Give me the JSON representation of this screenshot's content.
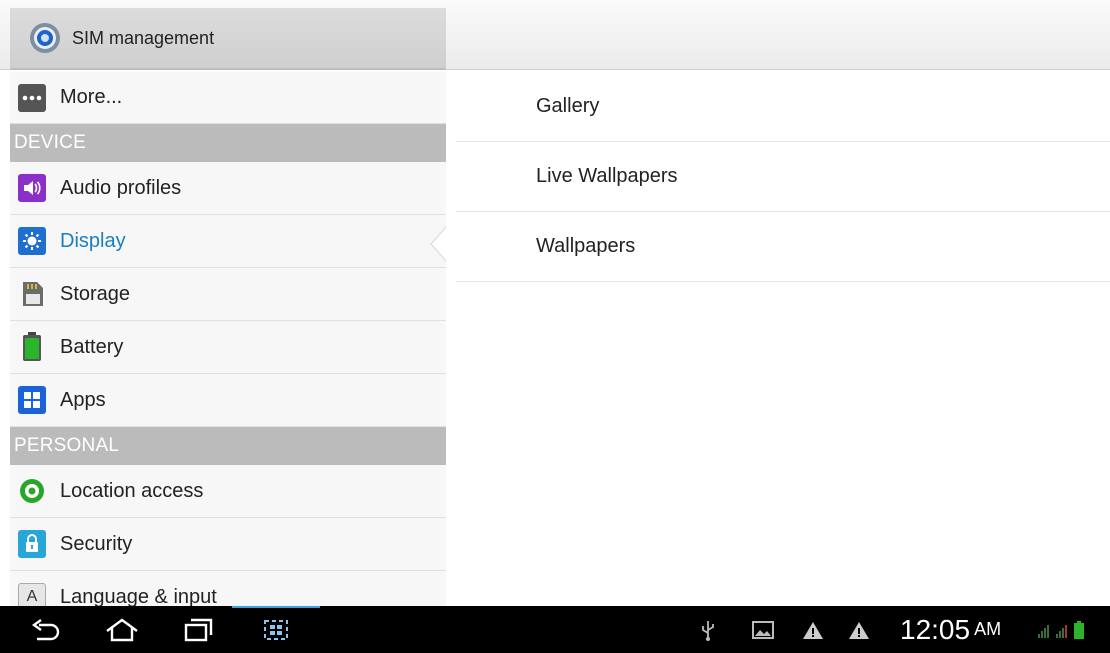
{
  "top": {
    "sim_label": "SIM management"
  },
  "left_menu": {
    "more_label": "More...",
    "device_header": "DEVICE",
    "items_device": [
      {
        "label": "Audio profiles",
        "icon": "speaker-icon"
      },
      {
        "label": "Display",
        "icon": "display-icon",
        "active": true
      },
      {
        "label": "Storage",
        "icon": "sd-card-icon"
      },
      {
        "label": "Battery",
        "icon": "battery-icon"
      },
      {
        "label": "Apps",
        "icon": "apps-grid-icon"
      }
    ],
    "personal_header": "PERSONAL",
    "items_personal": [
      {
        "label": "Location access",
        "icon": "location-icon"
      },
      {
        "label": "Security",
        "icon": "lock-icon"
      },
      {
        "label": "Language & input",
        "icon": "keyboard-a-icon"
      }
    ]
  },
  "right_panel": {
    "items": [
      "Gallery",
      "Live Wallpapers",
      "Wallpapers"
    ]
  },
  "status_bar": {
    "time": "12:05",
    "ampm": "AM"
  },
  "colors": {
    "active": "#1a7ec4",
    "header_bg": "#bbbbbb",
    "accent_line": "#3aa0e0"
  }
}
